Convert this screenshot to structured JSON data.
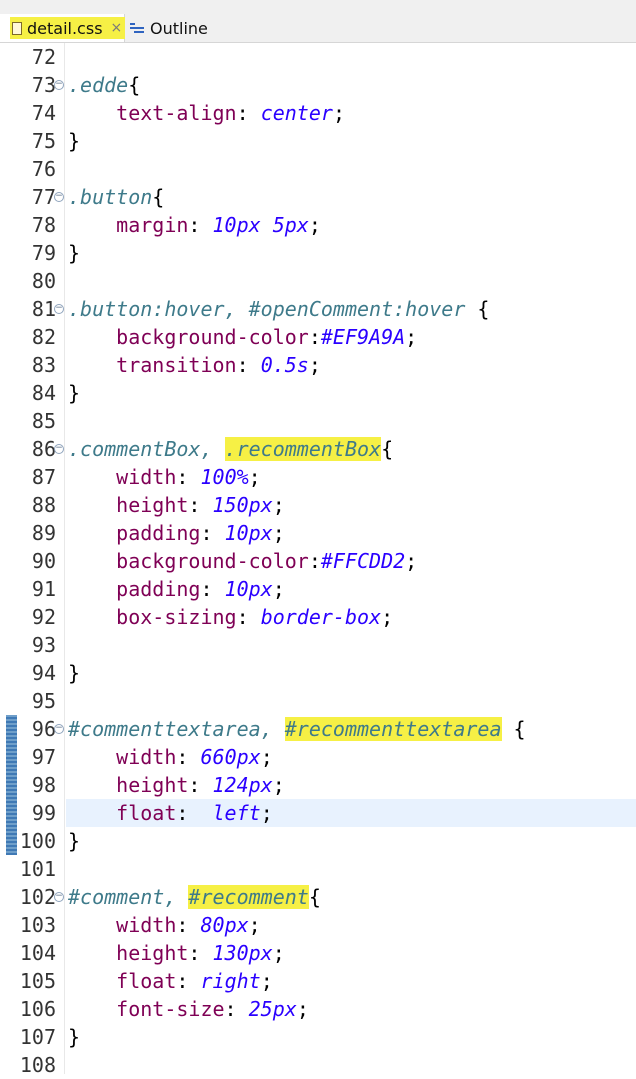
{
  "tabs": {
    "active_label": "detail.css",
    "close_glyph": "×",
    "outline_label": "Outline"
  },
  "editor": {
    "lines": [
      {
        "num": "72",
        "tokens": []
      },
      {
        "num": "73",
        "fold": true,
        "tokens": [
          {
            "t": ".edde",
            "c": "selector"
          },
          {
            "t": "{",
            "c": "punc"
          }
        ]
      },
      {
        "num": "74",
        "tokens": [
          {
            "t": "    ",
            "c": "punc"
          },
          {
            "t": "text-align",
            "c": "property"
          },
          {
            "t": ": ",
            "c": "punc"
          },
          {
            "t": "center",
            "c": "value"
          },
          {
            "t": ";",
            "c": "punc"
          }
        ]
      },
      {
        "num": "75",
        "tokens": [
          {
            "t": "}",
            "c": "punc"
          }
        ]
      },
      {
        "num": "76",
        "tokens": []
      },
      {
        "num": "77",
        "fold": true,
        "tokens": [
          {
            "t": ".button",
            "c": "selector"
          },
          {
            "t": "{",
            "c": "punc"
          }
        ]
      },
      {
        "num": "78",
        "tokens": [
          {
            "t": "    ",
            "c": "punc"
          },
          {
            "t": "margin",
            "c": "property"
          },
          {
            "t": ": ",
            "c": "punc"
          },
          {
            "t": "10px 5px",
            "c": "value"
          },
          {
            "t": ";",
            "c": "punc"
          }
        ]
      },
      {
        "num": "79",
        "tokens": [
          {
            "t": "}",
            "c": "punc"
          }
        ]
      },
      {
        "num": "80",
        "tokens": []
      },
      {
        "num": "81",
        "fold": true,
        "tokens": [
          {
            "t": ".button:hover, #openComment:hover",
            "c": "selector"
          },
          {
            "t": " {",
            "c": "punc"
          }
        ]
      },
      {
        "num": "82",
        "tokens": [
          {
            "t": "    ",
            "c": "punc"
          },
          {
            "t": "background-color",
            "c": "property"
          },
          {
            "t": ":",
            "c": "punc"
          },
          {
            "t": "#EF9A9A",
            "c": "value"
          },
          {
            "t": ";",
            "c": "punc"
          }
        ]
      },
      {
        "num": "83",
        "tokens": [
          {
            "t": "    ",
            "c": "punc"
          },
          {
            "t": "transition",
            "c": "property"
          },
          {
            "t": ": ",
            "c": "punc"
          },
          {
            "t": "0.5s",
            "c": "value"
          },
          {
            "t": ";",
            "c": "punc"
          }
        ]
      },
      {
        "num": "84",
        "tokens": [
          {
            "t": "}",
            "c": "punc"
          }
        ]
      },
      {
        "num": "85",
        "tokens": []
      },
      {
        "num": "86",
        "fold": true,
        "tokens": [
          {
            "t": ".commentBox, ",
            "c": "selector"
          },
          {
            "t": ".recommentBox",
            "c": "selector",
            "hl": true
          },
          {
            "t": "{",
            "c": "punc"
          }
        ]
      },
      {
        "num": "87",
        "tokens": [
          {
            "t": "    ",
            "c": "punc"
          },
          {
            "t": "width",
            "c": "property"
          },
          {
            "t": ": ",
            "c": "punc"
          },
          {
            "t": "100%",
            "c": "value"
          },
          {
            "t": ";",
            "c": "punc"
          }
        ]
      },
      {
        "num": "88",
        "tokens": [
          {
            "t": "    ",
            "c": "punc"
          },
          {
            "t": "height",
            "c": "property"
          },
          {
            "t": ": ",
            "c": "punc"
          },
          {
            "t": "150px",
            "c": "value"
          },
          {
            "t": ";",
            "c": "punc"
          }
        ]
      },
      {
        "num": "89",
        "tokens": [
          {
            "t": "    ",
            "c": "punc"
          },
          {
            "t": "padding",
            "c": "property"
          },
          {
            "t": ": ",
            "c": "punc"
          },
          {
            "t": "10px",
            "c": "value"
          },
          {
            "t": ";",
            "c": "punc"
          }
        ]
      },
      {
        "num": "90",
        "tokens": [
          {
            "t": "    ",
            "c": "punc"
          },
          {
            "t": "background-color",
            "c": "property"
          },
          {
            "t": ":",
            "c": "punc"
          },
          {
            "t": "#FFCDD2",
            "c": "value"
          },
          {
            "t": ";",
            "c": "punc"
          }
        ]
      },
      {
        "num": "91",
        "tokens": [
          {
            "t": "    ",
            "c": "punc"
          },
          {
            "t": "padding",
            "c": "property"
          },
          {
            "t": ": ",
            "c": "punc"
          },
          {
            "t": "10px",
            "c": "value"
          },
          {
            "t": ";",
            "c": "punc"
          }
        ]
      },
      {
        "num": "92",
        "tokens": [
          {
            "t": "    ",
            "c": "punc"
          },
          {
            "t": "box-sizing",
            "c": "property"
          },
          {
            "t": ": ",
            "c": "punc"
          },
          {
            "t": "border-box",
            "c": "value"
          },
          {
            "t": ";",
            "c": "punc"
          }
        ]
      },
      {
        "num": "93",
        "tokens": []
      },
      {
        "num": "94",
        "tokens": [
          {
            "t": "}",
            "c": "punc"
          }
        ]
      },
      {
        "num": "95",
        "tokens": []
      },
      {
        "num": "96",
        "fold": true,
        "tokens": [
          {
            "t": "#commenttextarea, ",
            "c": "selector"
          },
          {
            "t": "#recommenttextarea",
            "c": "selector",
            "hl": true
          },
          {
            "t": " {",
            "c": "punc"
          }
        ]
      },
      {
        "num": "97",
        "tokens": [
          {
            "t": "    ",
            "c": "punc"
          },
          {
            "t": "width",
            "c": "property"
          },
          {
            "t": ": ",
            "c": "punc"
          },
          {
            "t": "660px",
            "c": "value"
          },
          {
            "t": ";",
            "c": "punc"
          }
        ]
      },
      {
        "num": "98",
        "tokens": [
          {
            "t": "    ",
            "c": "punc"
          },
          {
            "t": "height",
            "c": "property"
          },
          {
            "t": ": ",
            "c": "punc"
          },
          {
            "t": "124px",
            "c": "value"
          },
          {
            "t": ";",
            "c": "punc"
          }
        ]
      },
      {
        "num": "99",
        "current": true,
        "tokens": [
          {
            "t": "    ",
            "c": "punc"
          },
          {
            "t": "float",
            "c": "property"
          },
          {
            "t": ":  ",
            "c": "punc"
          },
          {
            "t": "left",
            "c": "value"
          },
          {
            "t": ";",
            "c": "punc"
          }
        ]
      },
      {
        "num": "100",
        "tokens": [
          {
            "t": "}",
            "c": "punc"
          }
        ]
      },
      {
        "num": "101",
        "tokens": []
      },
      {
        "num": "102",
        "fold": true,
        "tokens": [
          {
            "t": "#comment, ",
            "c": "selector"
          },
          {
            "t": "#recomment",
            "c": "selector",
            "hl": true
          },
          {
            "t": "{",
            "c": "punc"
          }
        ]
      },
      {
        "num": "103",
        "tokens": [
          {
            "t": "    ",
            "c": "punc"
          },
          {
            "t": "width",
            "c": "property"
          },
          {
            "t": ": ",
            "c": "punc"
          },
          {
            "t": "80px",
            "c": "value"
          },
          {
            "t": ";",
            "c": "punc"
          }
        ]
      },
      {
        "num": "104",
        "tokens": [
          {
            "t": "    ",
            "c": "punc"
          },
          {
            "t": "height",
            "c": "property"
          },
          {
            "t": ": ",
            "c": "punc"
          },
          {
            "t": "130px",
            "c": "value"
          },
          {
            "t": ";",
            "c": "punc"
          }
        ]
      },
      {
        "num": "105",
        "tokens": [
          {
            "t": "    ",
            "c": "punc"
          },
          {
            "t": "float",
            "c": "property"
          },
          {
            "t": ": ",
            "c": "punc"
          },
          {
            "t": "right",
            "c": "value"
          },
          {
            "t": ";",
            "c": "punc"
          }
        ]
      },
      {
        "num": "106",
        "tokens": [
          {
            "t": "    ",
            "c": "punc"
          },
          {
            "t": "font-size",
            "c": "property"
          },
          {
            "t": ": ",
            "c": "punc"
          },
          {
            "t": "25px",
            "c": "value"
          },
          {
            "t": ";",
            "c": "punc"
          }
        ]
      },
      {
        "num": "107",
        "tokens": [
          {
            "t": "}",
            "c": "punc"
          }
        ]
      },
      {
        "num": "108",
        "tokens": []
      }
    ]
  }
}
